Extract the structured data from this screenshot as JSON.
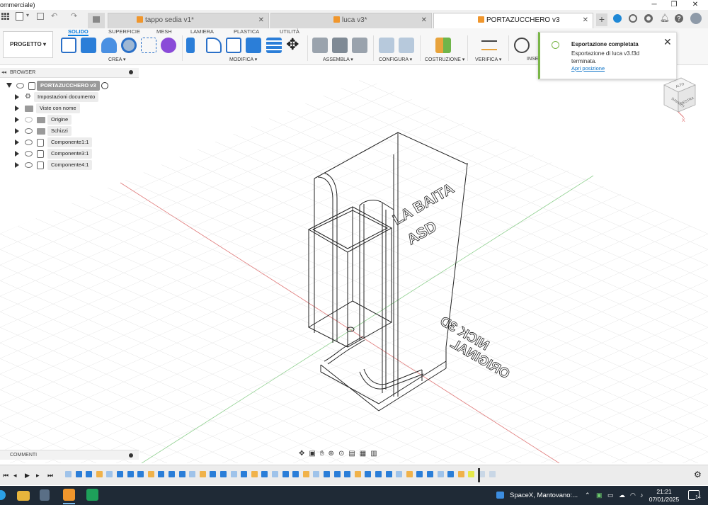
{
  "window": {
    "title": "ommerciale)"
  },
  "tabs": [
    {
      "label": "tappo sedia v1*"
    },
    {
      "label": "luca v3*"
    },
    {
      "label": "PORTAZUCCHERO v3"
    }
  ],
  "ribbon": {
    "workspace_label": "PROGETTO",
    "tabs": [
      "SOLIDO",
      "SUPERFICIE",
      "MESH",
      "LAMIERA",
      "PLASTICA",
      "UTILITÀ"
    ],
    "groups": [
      "CREA",
      "MODIFICA",
      "ASSEMBLA",
      "CONFIGURA",
      "COSTRUZIONE",
      "VERIFICA",
      "INSE"
    ]
  },
  "browser": {
    "title": "BROWSER",
    "root": "PORTAZUCCHERO v3",
    "items": [
      "Impostazioni documento",
      "Viste con nome",
      "Origine",
      "Schizzi",
      "Componente1:1",
      "Componente3:1",
      "Componente4:1"
    ]
  },
  "comments": {
    "title": "COMMENTI"
  },
  "toast": {
    "title": "Esportazione completata",
    "message": "Esportazione di luca v3.f3d terminata.",
    "link": "Apri posizione"
  },
  "model": {
    "line1": "LA BAITA",
    "line2": "ASD",
    "line3": "NICK 3D",
    "line4": "ORIGINAL"
  },
  "viewcube": {
    "front": "DAVANTI",
    "right": "DESTRA",
    "top": "ALTO",
    "axis_x": "X"
  },
  "taskbar": {
    "weather": "SpaceX, Mantovano:...",
    "time": "21:21",
    "date": "07/01/2025",
    "notifications": "14"
  },
  "colors": {
    "accent": "#0a7ee0",
    "toast_accent": "#7ab648",
    "taskbar": "#1f2a36",
    "fusion": "#f0962c"
  }
}
